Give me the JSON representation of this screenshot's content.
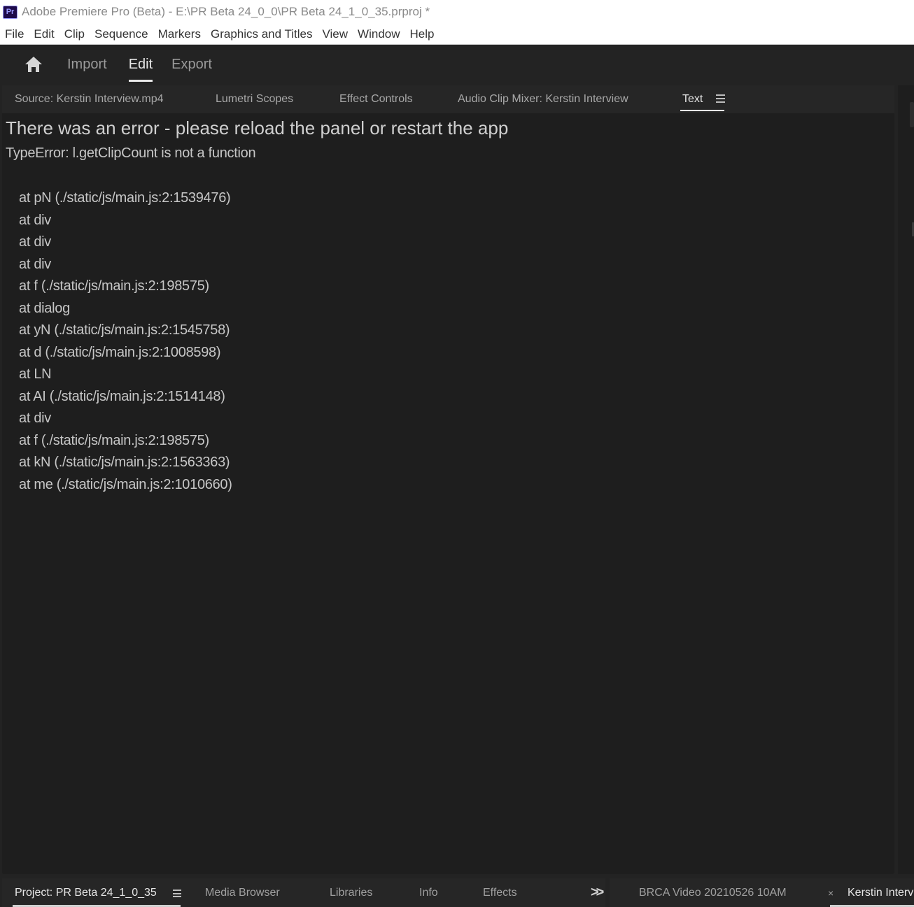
{
  "window": {
    "app_icon_text": "Pr",
    "title": "Adobe Premiere Pro (Beta) - E:\\PR Beta 24_0_0\\PR Beta 24_1_0_35.prproj *"
  },
  "menu": [
    "File",
    "Edit",
    "Clip",
    "Sequence",
    "Markers",
    "Graphics and Titles",
    "View",
    "Window",
    "Help"
  ],
  "workspace": {
    "tabs": [
      "Import",
      "Edit",
      "Export"
    ],
    "active_tab": "Edit"
  },
  "panel": {
    "tabs": [
      "Source: Kerstin Interview.mp4",
      "Lumetri Scopes",
      "Effect Controls",
      "Audio Clip Mixer: Kerstin Interview",
      "Text"
    ],
    "active_tab": "Text",
    "error_title": "There was an error - please reload the panel or restart the app",
    "error_type": "TypeError: l.getClipCount is not a function",
    "stack": [
      "at pN (./static/js/main.js:2:1539476)",
      "at div",
      "at div",
      "at div",
      "at f (./static/js/main.js:2:198575)",
      "at dialog",
      "at yN (./static/js/main.js:2:1545758)",
      "at d (./static/js/main.js:2:1008598)",
      "at LN",
      "at AI (./static/js/main.js:2:1514148)",
      "at div",
      "at f (./static/js/main.js:2:198575)",
      "at kN (./static/js/main.js:2:1563363)",
      "at me (./static/js/main.js:2:1010660)"
    ]
  },
  "bottom_left": {
    "tabs": [
      "Project: PR Beta 24_1_0_35",
      "Media Browser",
      "Libraries",
      "Info",
      "Effects"
    ],
    "active_tab": "Project: PR Beta 24_1_0_35",
    "overflow_icon": ">>"
  },
  "bottom_right": {
    "tabs": [
      "BRCA Video 20210526 10AM",
      "Kerstin Interv"
    ],
    "active_tab": "Kerstin Interv",
    "close_icon": "×"
  },
  "colors": {
    "background": "#232323",
    "panel": "#1e1e1e",
    "tab_bar": "#262626",
    "text": "#c6c6c6",
    "active": "#e6e6e6"
  }
}
